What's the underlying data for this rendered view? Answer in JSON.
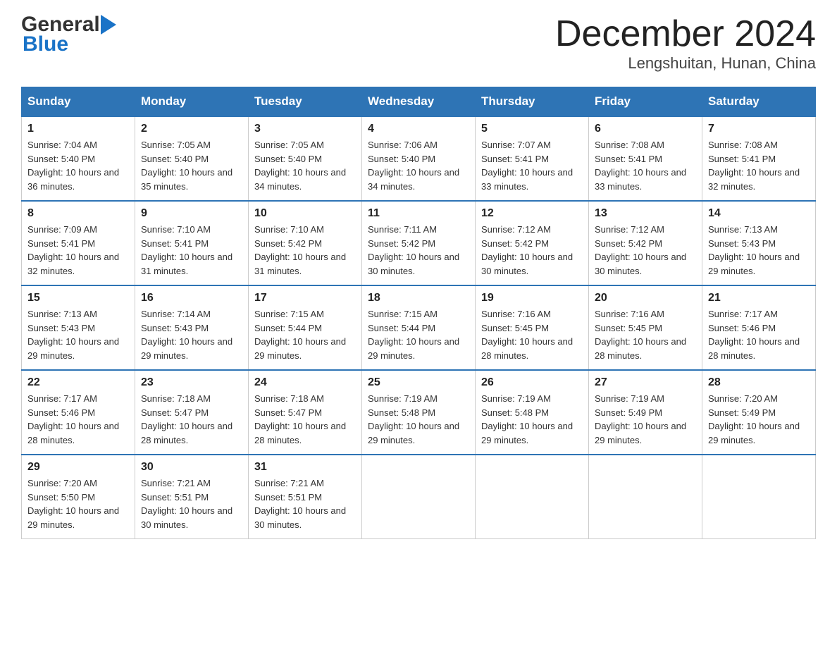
{
  "header": {
    "logo": {
      "general": "General",
      "blue": "Blue",
      "triangle_char": "▶"
    },
    "title": "December 2024",
    "subtitle": "Lengshuitan, Hunan, China"
  },
  "days_of_week": [
    "Sunday",
    "Monday",
    "Tuesday",
    "Wednesday",
    "Thursday",
    "Friday",
    "Saturday"
  ],
  "weeks": [
    [
      {
        "day": "1",
        "sunrise": "7:04 AM",
        "sunset": "5:40 PM",
        "daylight": "10 hours and 36 minutes."
      },
      {
        "day": "2",
        "sunrise": "7:05 AM",
        "sunset": "5:40 PM",
        "daylight": "10 hours and 35 minutes."
      },
      {
        "day": "3",
        "sunrise": "7:05 AM",
        "sunset": "5:40 PM",
        "daylight": "10 hours and 34 minutes."
      },
      {
        "day": "4",
        "sunrise": "7:06 AM",
        "sunset": "5:40 PM",
        "daylight": "10 hours and 34 minutes."
      },
      {
        "day": "5",
        "sunrise": "7:07 AM",
        "sunset": "5:41 PM",
        "daylight": "10 hours and 33 minutes."
      },
      {
        "day": "6",
        "sunrise": "7:08 AM",
        "sunset": "5:41 PM",
        "daylight": "10 hours and 33 minutes."
      },
      {
        "day": "7",
        "sunrise": "7:08 AM",
        "sunset": "5:41 PM",
        "daylight": "10 hours and 32 minutes."
      }
    ],
    [
      {
        "day": "8",
        "sunrise": "7:09 AM",
        "sunset": "5:41 PM",
        "daylight": "10 hours and 32 minutes."
      },
      {
        "day": "9",
        "sunrise": "7:10 AM",
        "sunset": "5:41 PM",
        "daylight": "10 hours and 31 minutes."
      },
      {
        "day": "10",
        "sunrise": "7:10 AM",
        "sunset": "5:42 PM",
        "daylight": "10 hours and 31 minutes."
      },
      {
        "day": "11",
        "sunrise": "7:11 AM",
        "sunset": "5:42 PM",
        "daylight": "10 hours and 30 minutes."
      },
      {
        "day": "12",
        "sunrise": "7:12 AM",
        "sunset": "5:42 PM",
        "daylight": "10 hours and 30 minutes."
      },
      {
        "day": "13",
        "sunrise": "7:12 AM",
        "sunset": "5:42 PM",
        "daylight": "10 hours and 30 minutes."
      },
      {
        "day": "14",
        "sunrise": "7:13 AM",
        "sunset": "5:43 PM",
        "daylight": "10 hours and 29 minutes."
      }
    ],
    [
      {
        "day": "15",
        "sunrise": "7:13 AM",
        "sunset": "5:43 PM",
        "daylight": "10 hours and 29 minutes."
      },
      {
        "day": "16",
        "sunrise": "7:14 AM",
        "sunset": "5:43 PM",
        "daylight": "10 hours and 29 minutes."
      },
      {
        "day": "17",
        "sunrise": "7:15 AM",
        "sunset": "5:44 PM",
        "daylight": "10 hours and 29 minutes."
      },
      {
        "day": "18",
        "sunrise": "7:15 AM",
        "sunset": "5:44 PM",
        "daylight": "10 hours and 29 minutes."
      },
      {
        "day": "19",
        "sunrise": "7:16 AM",
        "sunset": "5:45 PM",
        "daylight": "10 hours and 28 minutes."
      },
      {
        "day": "20",
        "sunrise": "7:16 AM",
        "sunset": "5:45 PM",
        "daylight": "10 hours and 28 minutes."
      },
      {
        "day": "21",
        "sunrise": "7:17 AM",
        "sunset": "5:46 PM",
        "daylight": "10 hours and 28 minutes."
      }
    ],
    [
      {
        "day": "22",
        "sunrise": "7:17 AM",
        "sunset": "5:46 PM",
        "daylight": "10 hours and 28 minutes."
      },
      {
        "day": "23",
        "sunrise": "7:18 AM",
        "sunset": "5:47 PM",
        "daylight": "10 hours and 28 minutes."
      },
      {
        "day": "24",
        "sunrise": "7:18 AM",
        "sunset": "5:47 PM",
        "daylight": "10 hours and 28 minutes."
      },
      {
        "day": "25",
        "sunrise": "7:19 AM",
        "sunset": "5:48 PM",
        "daylight": "10 hours and 29 minutes."
      },
      {
        "day": "26",
        "sunrise": "7:19 AM",
        "sunset": "5:48 PM",
        "daylight": "10 hours and 29 minutes."
      },
      {
        "day": "27",
        "sunrise": "7:19 AM",
        "sunset": "5:49 PM",
        "daylight": "10 hours and 29 minutes."
      },
      {
        "day": "28",
        "sunrise": "7:20 AM",
        "sunset": "5:49 PM",
        "daylight": "10 hours and 29 minutes."
      }
    ],
    [
      {
        "day": "29",
        "sunrise": "7:20 AM",
        "sunset": "5:50 PM",
        "daylight": "10 hours and 29 minutes."
      },
      {
        "day": "30",
        "sunrise": "7:21 AM",
        "sunset": "5:51 PM",
        "daylight": "10 hours and 30 minutes."
      },
      {
        "day": "31",
        "sunrise": "7:21 AM",
        "sunset": "5:51 PM",
        "daylight": "10 hours and 30 minutes."
      },
      null,
      null,
      null,
      null
    ]
  ],
  "labels": {
    "sunrise": "Sunrise:",
    "sunset": "Sunset:",
    "daylight": "Daylight:"
  },
  "colors": {
    "header_bg": "#2e74b5",
    "header_text": "#ffffff",
    "border": "#cccccc",
    "top_border": "#2e74b5"
  }
}
